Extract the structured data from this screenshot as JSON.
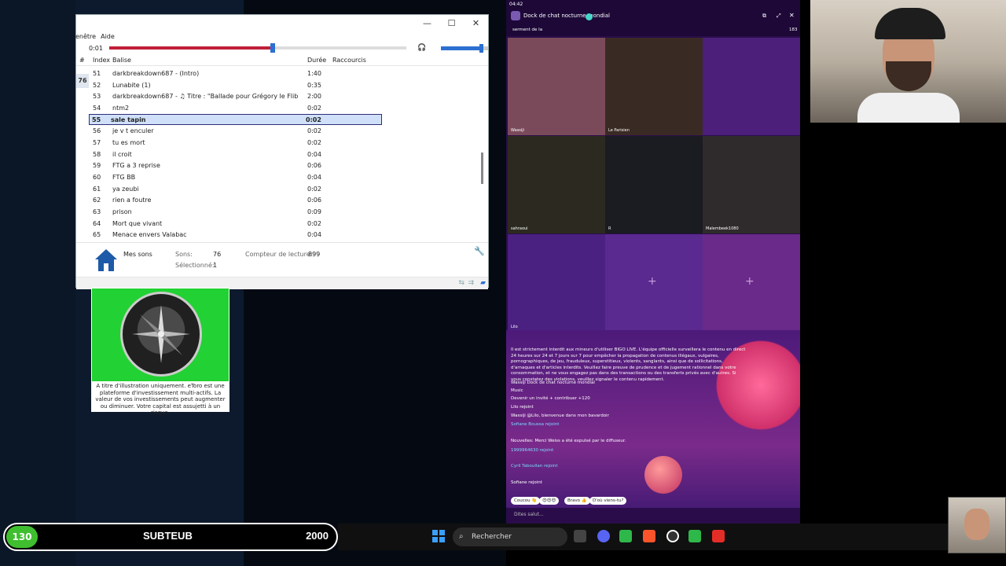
{
  "player": {
    "menu": [
      "enêtre",
      "Aide"
    ],
    "elapsed": "0:01",
    "progress": 0.55,
    "volume": 0.85,
    "columns": {
      "hash": "#",
      "index": "Index",
      "tag": "Balise",
      "duration": "Durée",
      "shortcuts": "Raccourcis"
    },
    "side_badge": "76",
    "rows": [
      {
        "index": "51",
        "tag": "darkbreakdown687 - (Intro)",
        "duration": "1:40"
      },
      {
        "index": "52",
        "tag": "Lunabite (1)",
        "duration": "0:35"
      },
      {
        "index": "53",
        "tag": "darkbreakdown687 - ♫ Titre : \"Ballade pour Grégory le Flib",
        "duration": "2:00"
      },
      {
        "index": "54",
        "tag": "ntm2",
        "duration": "0:02"
      },
      {
        "index": "55",
        "tag": "sale tapin",
        "duration": "0:02",
        "selected": true
      },
      {
        "index": "56",
        "tag": "je v t enculer",
        "duration": "0:02"
      },
      {
        "index": "57",
        "tag": "tu es mort",
        "duration": "0:02"
      },
      {
        "index": "58",
        "tag": "il croit",
        "duration": "0:04"
      },
      {
        "index": "59",
        "tag": "FTG a 3 reprise",
        "duration": "0:06"
      },
      {
        "index": "60",
        "tag": "FTG BB",
        "duration": "0:04"
      },
      {
        "index": "61",
        "tag": "ya zeubi",
        "duration": "0:02"
      },
      {
        "index": "62",
        "tag": "rien a foutre",
        "duration": "0:06"
      },
      {
        "index": "63",
        "tag": "prison",
        "duration": "0:09"
      },
      {
        "index": "64",
        "tag": "Mort que vivant",
        "duration": "0:02"
      },
      {
        "index": "65",
        "tag": "Menace envers Valabac",
        "duration": "0:04"
      }
    ],
    "footer": {
      "folder": "Mes sons",
      "sounds_label": "Sons:",
      "sounds_value": "76",
      "counter_label": "Compteur de lecture:",
      "counter_value": "899",
      "selected_label": "Sélectionné:",
      "selected_value": "1"
    }
  },
  "ad": {
    "caption": "A titre d'illustration uniquement. eToro est une plateforme d'investissement multi-actifs. La valeur de vos investissements peut augmenter ou diminuer. Votre capital est assujetti à un risque."
  },
  "bigo": {
    "clock": "04:42",
    "room_title": "Dock de chat nocturne mondial",
    "sub_line": "serment de la",
    "viewers": "183",
    "tiles": [
      {
        "label": "Wassiji",
        "color": "#7a4a5a"
      },
      {
        "label": "Le Parisien",
        "color": "#3a2a24"
      },
      {
        "label": "",
        "color": "#4b1f7a"
      },
      {
        "label": "sahraoui",
        "color": "#2c2a20"
      },
      {
        "label": "R",
        "color": "#1b1b22"
      },
      {
        "label": "Malembeek1080",
        "color": "#2f2a2c"
      },
      {
        "label": "Lilo",
        "color": "#4a2080"
      },
      {
        "label": "",
        "color": "#5a2a90"
      },
      {
        "label": "",
        "color": "#6a2a8a"
      }
    ],
    "notice": "Il est strictement interdit aux mineurs d'utiliser BIGO LIVE. L'équipe officielle surveillera le contenu en direct 24 heures sur 24 et 7 jours sur 7 pour empêcher la propagation de contenus illégaux, vulgaires, pornographiques, de jeu, frauduleux, superstitieux, violents, sanglants, ainsi que de sollicitations, d'arnaques et d'articles interdits. Veuillez faire preuve de prudence et de jugement rationnel dans votre consommation, et ne vous engagez pas dans des transactions ou des transferts privés avec d'autres. Si vous constatez des violations, veuillez signaler le contenu rapidement.",
    "chat": [
      "Wassiji  Dock de chat nocturne mondial",
      "Music",
      "Devenir un invité + contribuer +120",
      "Lilo rejoint",
      "Wassiji  @Lilo, bienvenue dans mon bavardoir",
      "Sofiane Boussa rejoint",
      "Nouvelles: Merci Weiss a été expulsé par le diffuseur.",
      "1999964630 rejoint",
      "Cyril Taboullan rejoint",
      "Sofiane rejoint"
    ],
    "quick_replies": [
      "Coucou 👋",
      "😍😍😍",
      "Bravo 👍",
      "D'où viens-tu?"
    ],
    "input_placeholder": "Dites salut..."
  },
  "taskbar": {
    "search_label": "Rechercher"
  },
  "sub_goal": {
    "current": "130",
    "label": "SUBTEUB",
    "target": "2000"
  }
}
